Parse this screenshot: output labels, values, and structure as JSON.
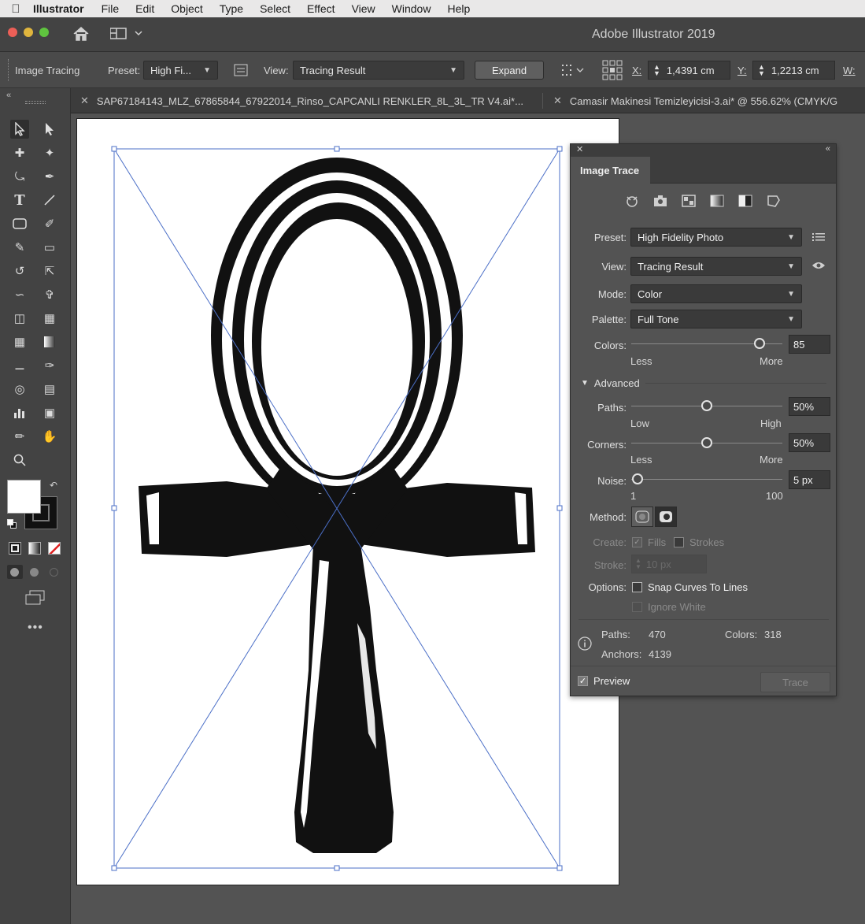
{
  "menubar": {
    "app": "Illustrator",
    "items": [
      "File",
      "Edit",
      "Object",
      "Type",
      "Select",
      "Effect",
      "View",
      "Window",
      "Help"
    ]
  },
  "window": {
    "title": "Adobe Illustrator 2019"
  },
  "controlbar": {
    "label": "Image Tracing",
    "preset_label": "Preset:",
    "preset_value": "High Fi...",
    "view_label": "View:",
    "view_value": "Tracing Result",
    "expand_label": "Expand",
    "x_label": "X:",
    "x_value": "1,4391 cm",
    "y_label": "Y:",
    "y_value": "1,2213 cm",
    "w_label": "W:"
  },
  "tabs": [
    {
      "label": "SAP67184143_MLZ_67865844_67922014_Rinso_CAPCANLI RENKLER_8L_3L_TR V4.ai*..."
    },
    {
      "label": "Camasir Makinesi Temizleyicisi-3.ai* @ 556.62% (CMYK/G"
    }
  ],
  "panel": {
    "title": "Image Trace",
    "preset_label": "Preset:",
    "preset_value": "High Fidelity Photo",
    "view_label": "View:",
    "view_value": "Tracing Result",
    "mode_label": "Mode:",
    "mode_value": "Color",
    "palette_label": "Palette:",
    "palette_value": "Full Tone",
    "colors_label": "Colors:",
    "colors_value": "85",
    "colors_min": "Less",
    "colors_max": "More",
    "colors_level": 0.85,
    "advanced_label": "Advanced",
    "paths_label": "Paths:",
    "paths_value": "50%",
    "paths_min": "Low",
    "paths_max": "High",
    "paths_level": 0.5,
    "corners_label": "Corners:",
    "corners_value": "50%",
    "corners_min": "Less",
    "corners_max": "More",
    "corners_level": 0.5,
    "noise_label": "Noise:",
    "noise_value": "5 px",
    "noise_min": "1",
    "noise_max": "100",
    "noise_level": 0.04,
    "method_label": "Method:",
    "create_label": "Create:",
    "fills_label": "Fills",
    "fills_checked": true,
    "strokes_label": "Strokes",
    "strokes_checked": false,
    "stroke_label": "Stroke:",
    "stroke_value": "10 px",
    "options_label": "Options:",
    "snap_label": "Snap Curves To Lines",
    "snap_checked": false,
    "ignore_white_label": "Ignore White",
    "ignore_white_checked": false,
    "stats_paths_label": "Paths:",
    "stats_paths_value": "470",
    "stats_colors_label": "Colors:",
    "stats_colors_value": "318",
    "stats_anchors_label": "Anchors:",
    "stats_anchors_value": "4139",
    "preview_label": "Preview",
    "preview_checked": true,
    "trace_label": "Trace"
  },
  "colors": {
    "selection": "#4b6fc7",
    "panel_bg": "#535353",
    "canvas_bg": "#ffffff",
    "artwork": "#111111"
  }
}
